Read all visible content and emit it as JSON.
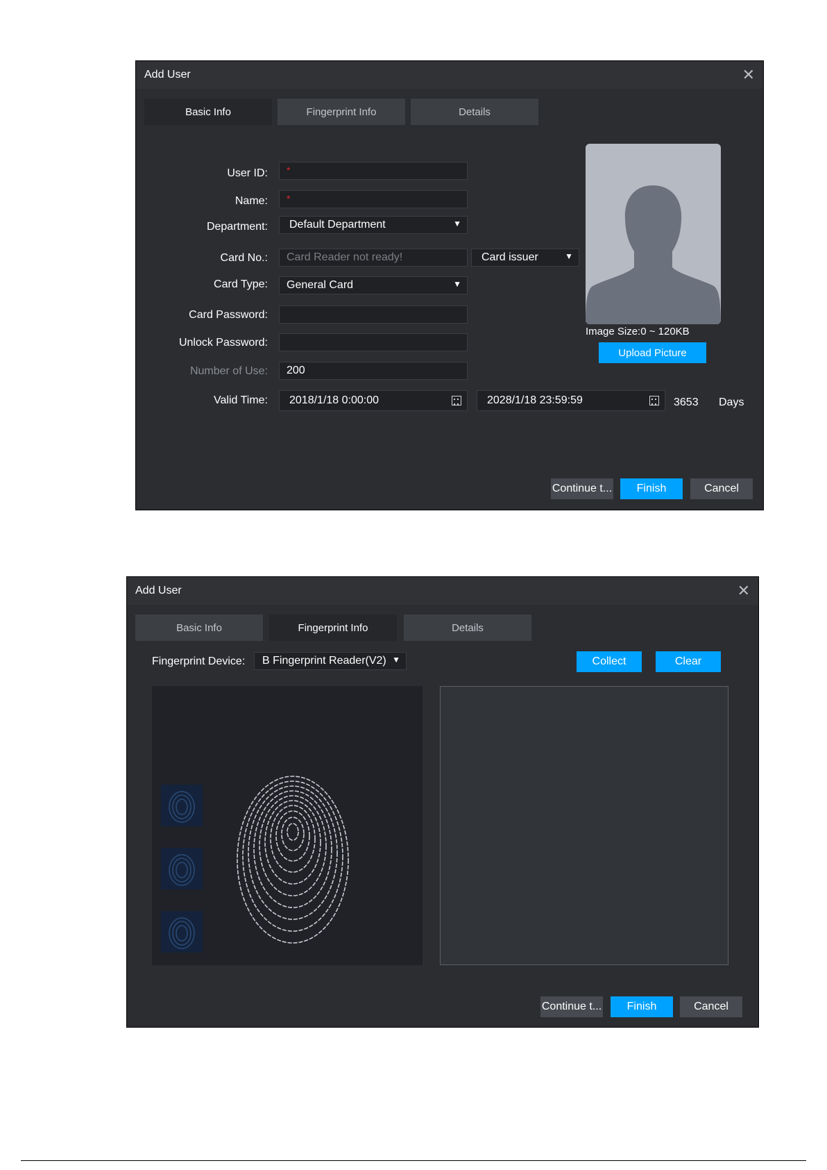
{
  "dialog1": {
    "title": "Add User",
    "tabs": [
      "Basic Info",
      "Fingerprint Info",
      "Details"
    ],
    "labels": {
      "user_id": "User ID:",
      "name": "Name:",
      "department": "Department:",
      "card_no": "Card No.:",
      "card_type": "Card Type:",
      "card_password": "Card Password:",
      "unlock_password": "Unlock Password:",
      "number_of_use": "Number of Use:",
      "valid_time": "Valid Time:"
    },
    "values": {
      "required_mark": "*",
      "department": "Default Department",
      "card_no_placeholder": "Card Reader not ready!",
      "card_issuer": "Card issuer",
      "card_type": "General Card",
      "card_password": "",
      "unlock_password": "",
      "number_of_use": "200",
      "valid_start": "2018/1/18 0:00:00",
      "valid_end": "2028/1/18 23:59:59",
      "days_count": "3653",
      "days_label": "Days"
    },
    "image_size": "Image Size:0 ~ 120KB",
    "upload_button": "Upload Picture",
    "buttons": {
      "continue": "Continue t...",
      "finish": "Finish",
      "cancel": "Cancel"
    }
  },
  "dialog2": {
    "title": "Add User",
    "tabs": [
      "Basic Info",
      "Fingerprint Info",
      "Details"
    ],
    "device_label": "Fingerprint Device:",
    "device_value": "B Fingerprint Reader(V2)",
    "collect": "Collect",
    "clear": "Clear",
    "buttons": {
      "continue": "Continue t...",
      "finish": "Finish",
      "cancel": "Cancel"
    }
  },
  "colors": {
    "accent": "#00a2ff",
    "dialog_bg": "#2b2d31",
    "required": "#e0262b"
  },
  "icons": [
    "close-icon",
    "dropdown-caret-icon",
    "calendar-icon",
    "avatar-placeholder-icon",
    "fingerprint-icon"
  ]
}
